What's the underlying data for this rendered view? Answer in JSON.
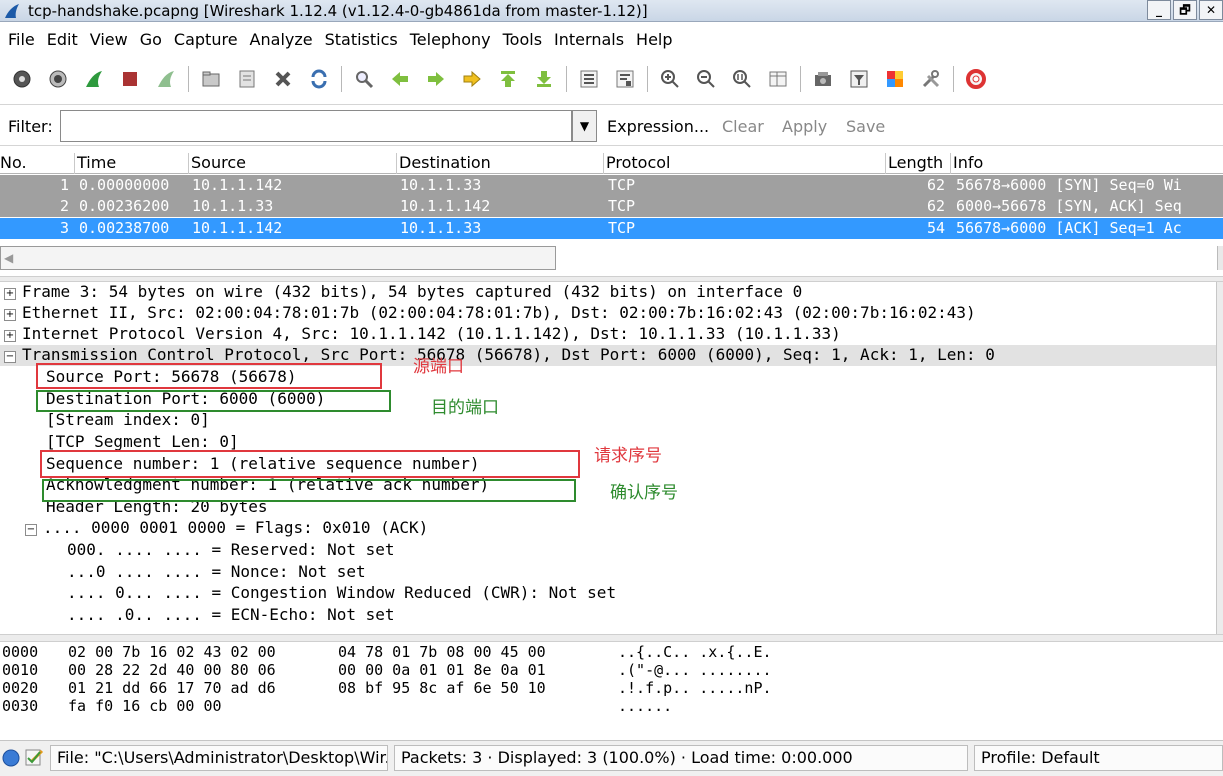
{
  "window": {
    "title": "tcp-handshake.pcapng  [Wireshark 1.12.4  (v1.12.4-0-gb4861da from master-1.12)]",
    "min_label": "_",
    "restore_label": "🗗",
    "close_label": "✕"
  },
  "menu": [
    "File",
    "Edit",
    "View",
    "Go",
    "Capture",
    "Analyze",
    "Statistics",
    "Telephony",
    "Tools",
    "Internals",
    "Help"
  ],
  "toolbar_icons": [
    "interface-list-icon",
    "capture-options-icon",
    "start-capture-icon",
    "stop-capture-icon",
    "restart-capture-icon",
    "open-file-icon",
    "save-file-icon",
    "close-file-icon",
    "reload-icon",
    "find-packet-icon",
    "go-back-icon",
    "go-forward-icon",
    "go-to-packet-icon",
    "go-first-icon",
    "go-last-icon",
    "colorize-icon",
    "autoscroll-icon",
    "zoom-in-icon",
    "zoom-out-icon",
    "zoom-normal-icon",
    "resize-columns-icon",
    "capture-filters-icon",
    "display-filters-icon",
    "coloring-rules-icon",
    "preferences-icon",
    "help-icon"
  ],
  "filter": {
    "label": "Filter:",
    "value": "",
    "links": [
      "Expression...",
      "Clear",
      "Apply",
      "Save"
    ]
  },
  "packet_list": {
    "columns": [
      "No.",
      "Time",
      "Source",
      "Destination",
      "Protocol",
      "Length",
      "Info"
    ],
    "rows": [
      {
        "no": "1",
        "time": "0.00000000",
        "source": "10.1.1.142",
        "destination": "10.1.1.33",
        "protocol": "TCP",
        "length": "62",
        "info": "56678→6000 [SYN] Seq=0 Wi"
      },
      {
        "no": "2",
        "time": "0.00236200",
        "source": "10.1.1.33",
        "destination": "10.1.1.142",
        "protocol": "TCP",
        "length": "62",
        "info": "6000→56678 [SYN, ACK] Seq"
      },
      {
        "no": "3",
        "time": "0.00238700",
        "source": "10.1.1.142",
        "destination": "10.1.1.33",
        "protocol": "TCP",
        "length": "54",
        "info": "56678→6000 [ACK] Seq=1 Ac"
      }
    ]
  },
  "details": {
    "frame": "Frame 3: 54 bytes on wire (432 bits), 54 bytes captured (432 bits) on interface 0",
    "ethernet": "Ethernet II, Src: 02:00:04:78:01:7b (02:00:04:78:01:7b), Dst: 02:00:7b:16:02:43 (02:00:7b:16:02:43)",
    "ip": "Internet Protocol Version 4, Src: 10.1.1.142 (10.1.1.142), Dst: 10.1.1.33 (10.1.1.33)",
    "tcp": "Transmission Control Protocol, Src Port: 56678 (56678), Dst Port: 6000 (6000), Seq: 1, Ack: 1, Len: 0",
    "src_port": "Source Port: 56678 (56678)",
    "dst_port": "Destination Port: 6000 (6000)",
    "stream_index": "[Stream index: 0]",
    "seg_len": "[TCP Segment Len: 0]",
    "seq": "Sequence number: 1    (relative sequence number)",
    "ack": "Acknowledgment number: 1    (relative ack number)",
    "hdr_len": "Header Length: 20 bytes",
    "flags": ".... 0000 0001 0000 = Flags: 0x010 (ACK)",
    "reserved": "000. .... .... = Reserved: Not set",
    "nonce": "...0 .... .... = Nonce: Not set",
    "cwr": ".... 0... .... = Congestion Window Reduced (CWR): Not set",
    "ecn": ".... .0.. .... = ECN-Echo: Not set",
    "expand_plus": "+",
    "expand_minus": "−"
  },
  "annotations": {
    "src_port": "源端口",
    "dst_port": "目的端口",
    "seq": "请求序号",
    "ack": "确认序号",
    "red": "#e0383e",
    "green": "#2e8b2e"
  },
  "bytes": [
    {
      "offset": "0000",
      "hex1": "02 00 7b 16 02 43 02 00",
      "hex2": "04 78 01 7b 08 00 45 00",
      "ascii": "..{..C.. .x.{..E."
    },
    {
      "offset": "0010",
      "hex1": "00 28 22 2d 40 00 80 06",
      "hex2": "00 00 0a 01 01 8e 0a 01",
      "ascii": ".(\"-@... ........"
    },
    {
      "offset": "0020",
      "hex1": "01 21 dd 66 17 70 ad d6",
      "hex2": "08 bf 95 8c af 6e 50 10",
      "ascii": ".!.f.p.. .....nP."
    },
    {
      "offset": "0030",
      "hex1": "fa f0 16 cb 00 00",
      "hex2": "",
      "ascii": "......"
    }
  ],
  "status": {
    "file": "File: \"C:\\Users\\Administrator\\Desktop\\Wir...",
    "packets": "Packets: 3 · Displayed: 3 (100.0%)  · Load time: 0:00.000",
    "profile": "Profile: Default"
  },
  "colors": {
    "selected_row": "#3399ff",
    "marked_row": "#a0a0a0"
  }
}
